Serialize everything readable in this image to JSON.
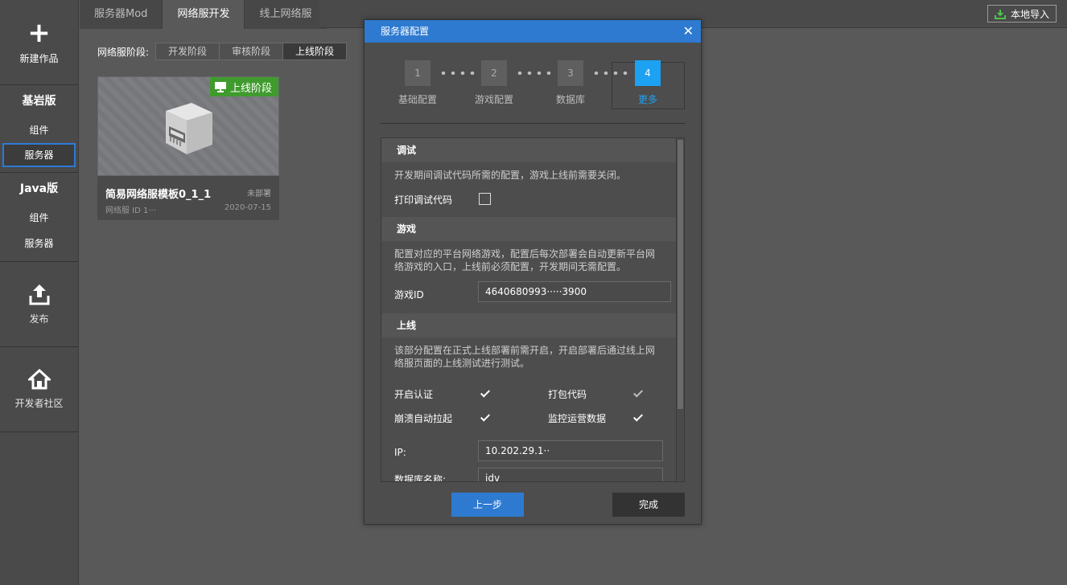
{
  "sidebar": {
    "new_label": "新建作品",
    "bedrock_head": "基岩版",
    "bedrock_component": "组件",
    "bedrock_server": "服务器",
    "java_head": "Java版",
    "java_component": "组件",
    "java_server": "服务器",
    "publish": "发布",
    "community": "开发者社区"
  },
  "tabs": [
    "服务器Mod",
    "网络服开发",
    "线上网络服"
  ],
  "toolbar": {
    "import_label": "本地导入"
  },
  "stage": {
    "label": "网络服阶段:",
    "options": [
      "开发阶段",
      "审核阶段",
      "上线阶段"
    ]
  },
  "card": {
    "badge": "上线阶段",
    "title": "简易网络服模板0_1_1",
    "status": "未部署",
    "id_text": "网络服 ID 1···",
    "date": "2020-07-15"
  },
  "dialog": {
    "title": "服务器配置",
    "close": "✕",
    "steps": [
      {
        "num": "1",
        "name": "基础配置"
      },
      {
        "num": "2",
        "name": "游戏配置"
      },
      {
        "num": "3",
        "name": "数据库"
      },
      {
        "num": "4",
        "name": "更多"
      }
    ],
    "debug": {
      "head": "调试",
      "desc": "开发期间调试代码所需的配置，游戏上线前需要关闭。",
      "print_label": "打印调试代码"
    },
    "game": {
      "head": "游戏",
      "desc": "配置对应的平台网络游戏，配置后每次部署会自动更新平台网络游戏的入口，上线前必须配置，开发期间无需配置。",
      "id_label": "游戏ID",
      "id_value": "4640680993·····3900"
    },
    "online": {
      "head": "上线",
      "desc": "该部分配置在正式上线部署前需开启，开启部署后通过线上网络服页面的上线测试进行测试。",
      "auth_label": "开启认证",
      "pack_label": "打包代码",
      "crash_label": "崩溃自动拉起",
      "monitor_label": "监控运营数据",
      "ip_label": "IP:",
      "ip_value": "10.202.29.1··",
      "db_label": "数据库名称:",
      "db_value": "idv"
    },
    "prev_label": "上一步",
    "done_label": "完成"
  },
  "colors": {
    "accent": "#2e7ad0",
    "active_step": "#1da1f2",
    "badge_green": "#3f9b2d"
  }
}
